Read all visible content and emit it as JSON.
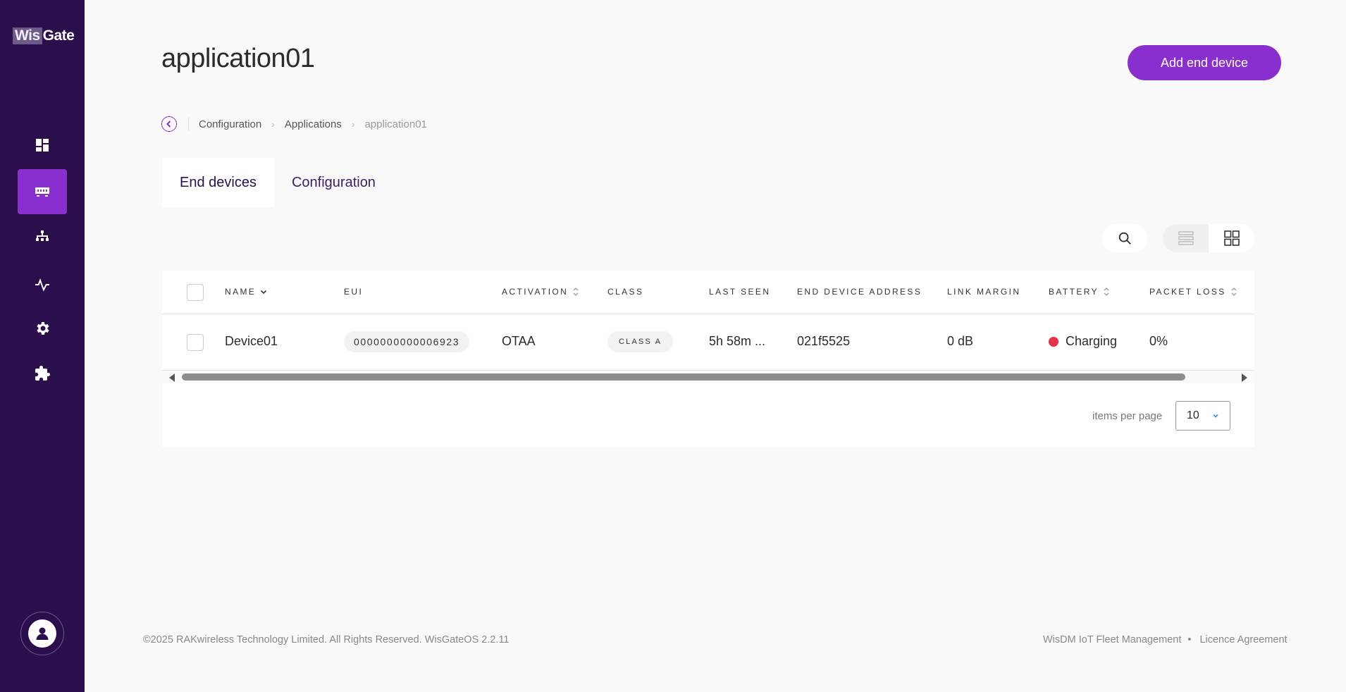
{
  "brand": {
    "logo_part1": "Wis",
    "logo_part2": "Gate"
  },
  "sidebar": {
    "items": [
      {
        "name": "dashboard",
        "icon": "dashboard-icon",
        "active": false
      },
      {
        "name": "gateway",
        "icon": "gateway-icon",
        "active": true
      },
      {
        "name": "network",
        "icon": "network-icon",
        "active": false
      },
      {
        "name": "monitoring",
        "icon": "activity-icon",
        "active": false
      },
      {
        "name": "settings",
        "icon": "gear-icon",
        "active": false
      },
      {
        "name": "extensions",
        "icon": "puzzle-icon",
        "active": false
      }
    ],
    "user_icon": "user-icon"
  },
  "page": {
    "title": "application01",
    "add_button": "Add end device"
  },
  "breadcrumb": {
    "items": [
      "Configuration",
      "Applications"
    ],
    "current": "application01"
  },
  "tabs": [
    {
      "label": "End devices",
      "active": true
    },
    {
      "label": "Configuration",
      "active": false
    }
  ],
  "table": {
    "columns": {
      "name": "NAME",
      "eui": "EUI",
      "activation": "ACTIVATION",
      "class": "CLASS",
      "last_seen": "LAST SEEN",
      "address": "END DEVICE ADDRESS",
      "link_margin": "LINK MARGIN",
      "battery": "BATTERY",
      "packet_loss": "PACKET LOSS"
    },
    "rows": [
      {
        "name": "Device01",
        "eui": "0000000000006923",
        "activation": "OTAA",
        "class": "CLASS A",
        "last_seen": "5h 58m ...",
        "address": "021f5525",
        "link_margin": "0 dB",
        "battery": "Charging",
        "battery_color": "#e6324b",
        "packet_loss": "0%"
      }
    ]
  },
  "pagination": {
    "label": "items per page",
    "value": "10"
  },
  "footer": {
    "copyright": "©2025 RAKwireless Technology Limited. All Rights Reserved. WisGateOS 2.2.11",
    "link1": "WisDM IoT Fleet Management",
    "separator": "•",
    "link2": "Licence Agreement"
  },
  "colors": {
    "sidebar": "#2b0f4c",
    "accent": "#8a2fcf"
  }
}
